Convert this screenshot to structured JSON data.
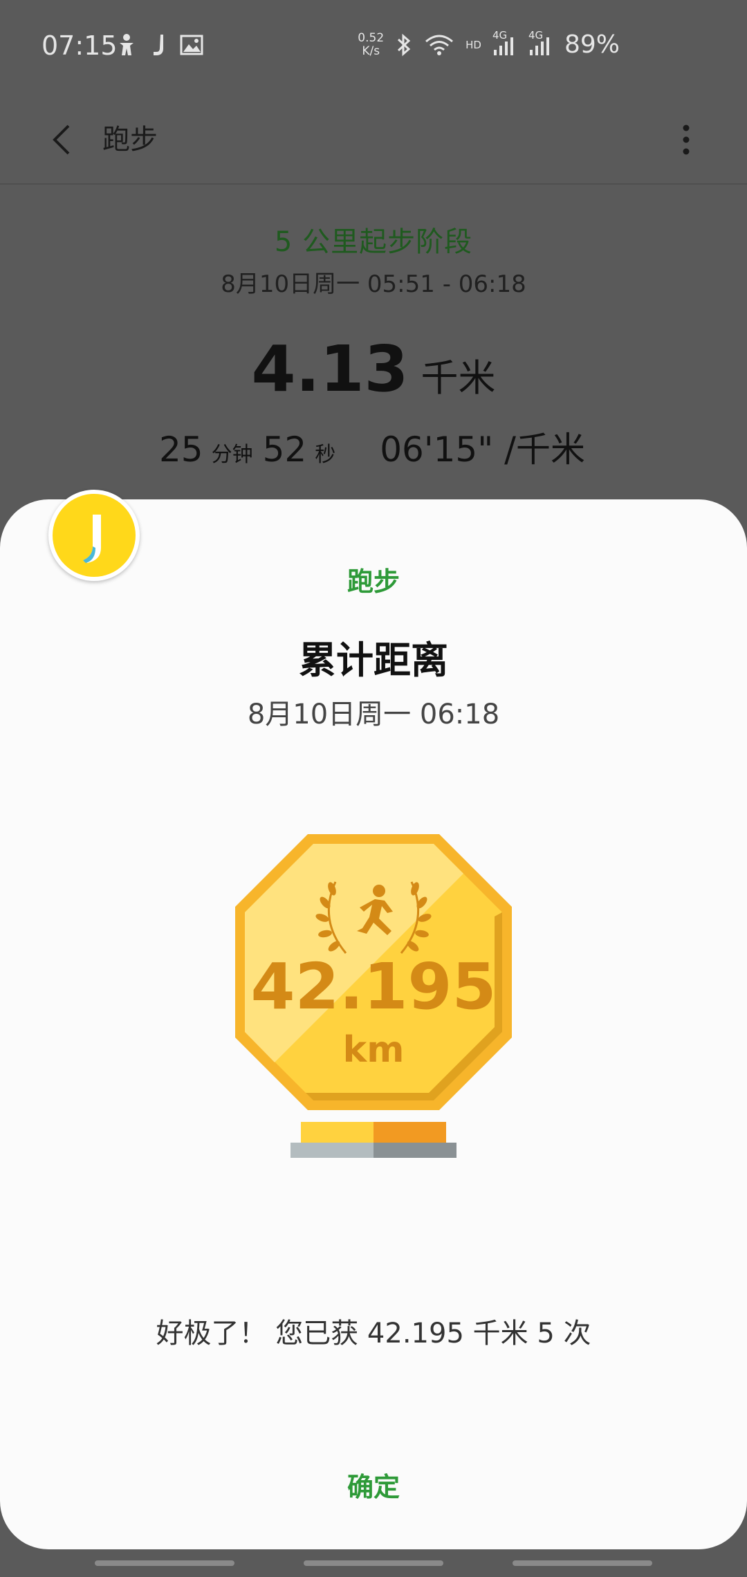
{
  "status_bar": {
    "time": "07:15",
    "left_icons": [
      "accessibility-icon",
      "app-j-icon",
      "image-icon"
    ],
    "net_speed_value": "0.52",
    "net_speed_unit": "K/s",
    "hd_label": "HD",
    "network_1": "4G",
    "network_2": "4G",
    "battery": "89%"
  },
  "app_bar": {
    "title": "跑步"
  },
  "summary": {
    "stage_title": "5 公里起步阶段",
    "time_range": "8月10日周一 05:51 - 06:18",
    "distance_value": "4.13",
    "distance_unit": "千米",
    "minutes_value": "25",
    "minutes_unit": "分钟",
    "seconds_value": "52",
    "seconds_unit": "秒",
    "pace": "06'15\" /千米"
  },
  "dialog": {
    "category": "跑步",
    "title": "累计距离",
    "date": "8月10日周一 06:18",
    "medal_value": "42.195",
    "medal_unit": "km",
    "message": "好极了！ 您已获 42.195 千米 5 次",
    "confirm_label": "确定"
  },
  "colors": {
    "accent_green": "#2e9a38",
    "stage_green": "#1f5a1f",
    "medal_gold": "#ffd23f",
    "medal_dark": "#d48a16",
    "logo_yellow": "#ffd81a"
  }
}
